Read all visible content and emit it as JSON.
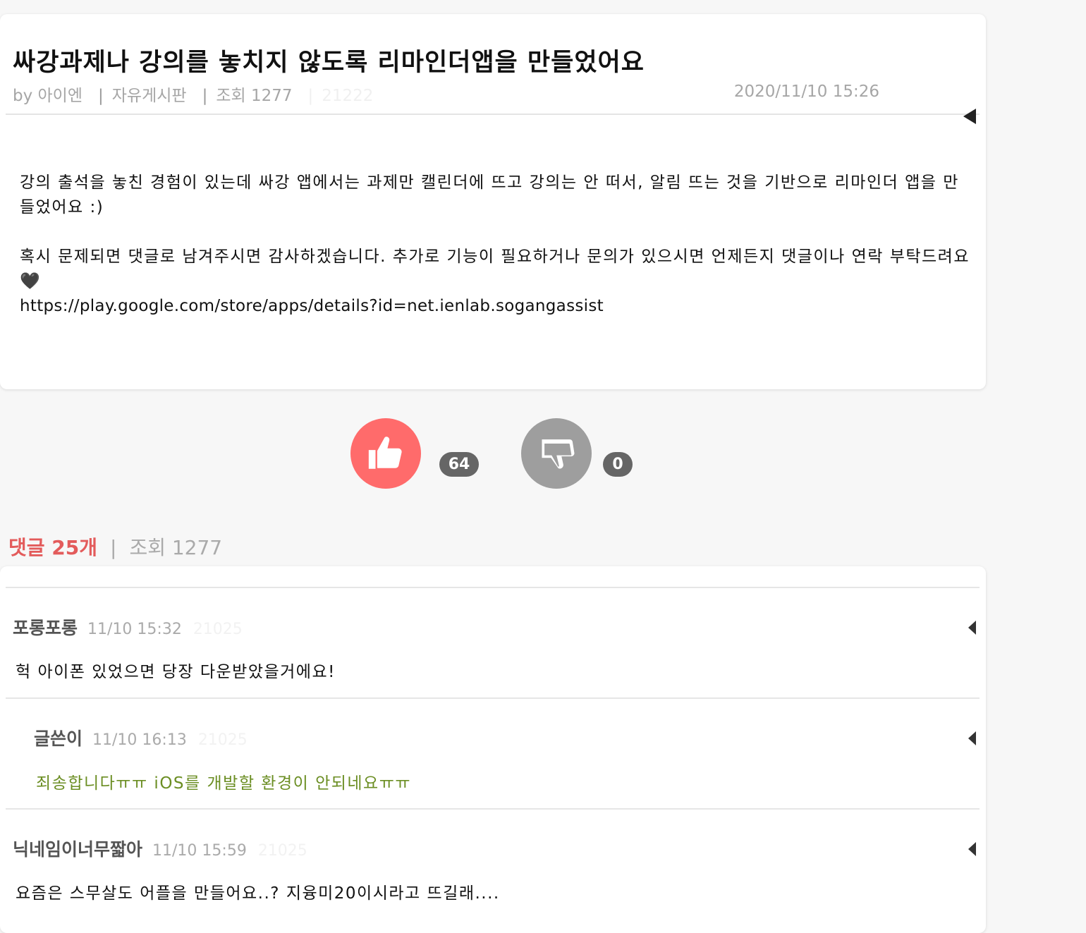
{
  "post": {
    "title": "싸강과제나 강의를 놓치지 않도록 리마인더앱을 만들었어요",
    "author": "by 아이엔",
    "board": "자유게시판",
    "views": "조회 1277",
    "faint_id": "21222",
    "date": "2020/11/10 15:26",
    "body_p1": "강의 출석을 놓친 경험이 있는데 싸강 앱에서는 과제만 캘린더에 뜨고 강의는 안 떠서, 알림 뜨는 것을 기반으로 리마인더 앱을 만들었어요 :)",
    "body_p2": "혹시 문제되면 댓글로 남겨주시면 감사하겠습니다. 추가로 기능이 필요하거나 문의가 있으시면 언제든지 댓글이나 연락 부탁드려요 🖤",
    "body_link": "https://play.google.com/store/apps/details?id=net.ienlab.sogangassist"
  },
  "votes": {
    "like_count": "64",
    "dislike_count": "0",
    "like_color": "#ff6b6b",
    "dislike_color": "#9e9e9e"
  },
  "comments_header": {
    "count_label": "댓글 25개",
    "sep": "|",
    "views": "조회 1277"
  },
  "comments": [
    {
      "author": "포롱포롱",
      "time": "11/10 15:32",
      "faint_id": "21025",
      "text": "헉 아이폰 있었으면 당장 다운받았을거에요!"
    },
    {
      "author": "글쓴이",
      "time": "11/10 16:13",
      "faint_id": "21025",
      "text": "죄송합니다ㅠㅠ iOS를 개발할 환경이 안되네요ㅠㅠ",
      "is_reply": true
    },
    {
      "author": "닉네임이너무짧아",
      "time": "11/10 15:59",
      "faint_id": "21025",
      "text": "요즘은 스무살도 어플을 만들어요..? 지융미20이시라고 뜨길래...."
    }
  ]
}
